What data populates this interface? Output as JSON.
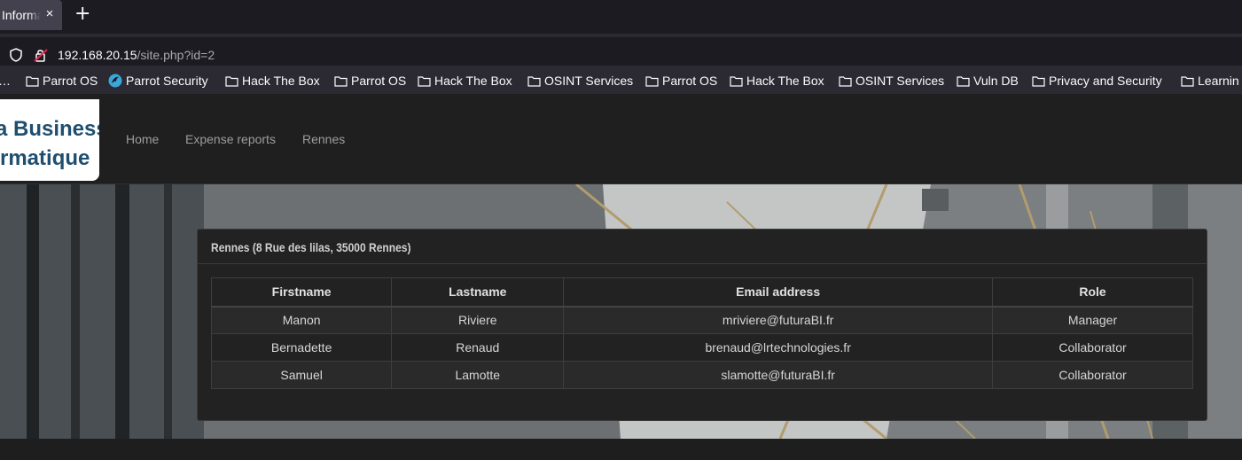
{
  "browser": {
    "tab": {
      "title": "Informat",
      "close_glyph": "×"
    },
    "new_tab_glyph": "+",
    "url": {
      "host": "192.168.20.15",
      "path": "/site.php?id=2"
    },
    "bookmarks": [
      {
        "label": "…",
        "icon": "none"
      },
      {
        "label": "Parrot OS",
        "icon": "folder-icon"
      },
      {
        "label": "Parrot Security",
        "icon": "parrot-icon"
      },
      {
        "label": "Hack The Box",
        "icon": "folder-icon"
      },
      {
        "label": "Parrot OS",
        "icon": "folder-icon"
      },
      {
        "label": "Hack The Box",
        "icon": "folder-icon"
      },
      {
        "label": "OSINT Services",
        "icon": "folder-icon"
      },
      {
        "label": "Parrot OS",
        "icon": "folder-icon"
      },
      {
        "label": "Hack The Box",
        "icon": "folder-icon"
      },
      {
        "label": "OSINT Services",
        "icon": "folder-icon"
      },
      {
        "label": "Vuln DB",
        "icon": "folder-icon"
      },
      {
        "label": "Privacy and Security",
        "icon": "folder-icon"
      },
      {
        "label": "Learnin",
        "icon": "folder-icon"
      }
    ]
  },
  "site": {
    "logo": {
      "line1": "a Business",
      "line2": "rmatique"
    },
    "nav": {
      "home": "Home",
      "expense": "Expense reports",
      "site": "Rennes"
    },
    "panel": {
      "title": "Rennes (8 Rue des lilas, 35000 Rennes)",
      "columns": [
        "Firstname",
        "Lastname",
        "Email address",
        "Role"
      ],
      "rows": [
        [
          "Manon",
          "Riviere",
          "mriviere@futuraBI.fr",
          "Manager"
        ],
        [
          "Bernadette",
          "Renaud",
          "brenaud@lrtechnologies.fr",
          "Collaborator"
        ],
        [
          "Samuel",
          "Lamotte",
          "slamotte@futuraBI.fr",
          "Collaborator"
        ]
      ]
    }
  },
  "colors": {
    "logo_text": "#1f4e6f",
    "nav_link": "#9d9d9d",
    "panel_bg": "#222222"
  }
}
